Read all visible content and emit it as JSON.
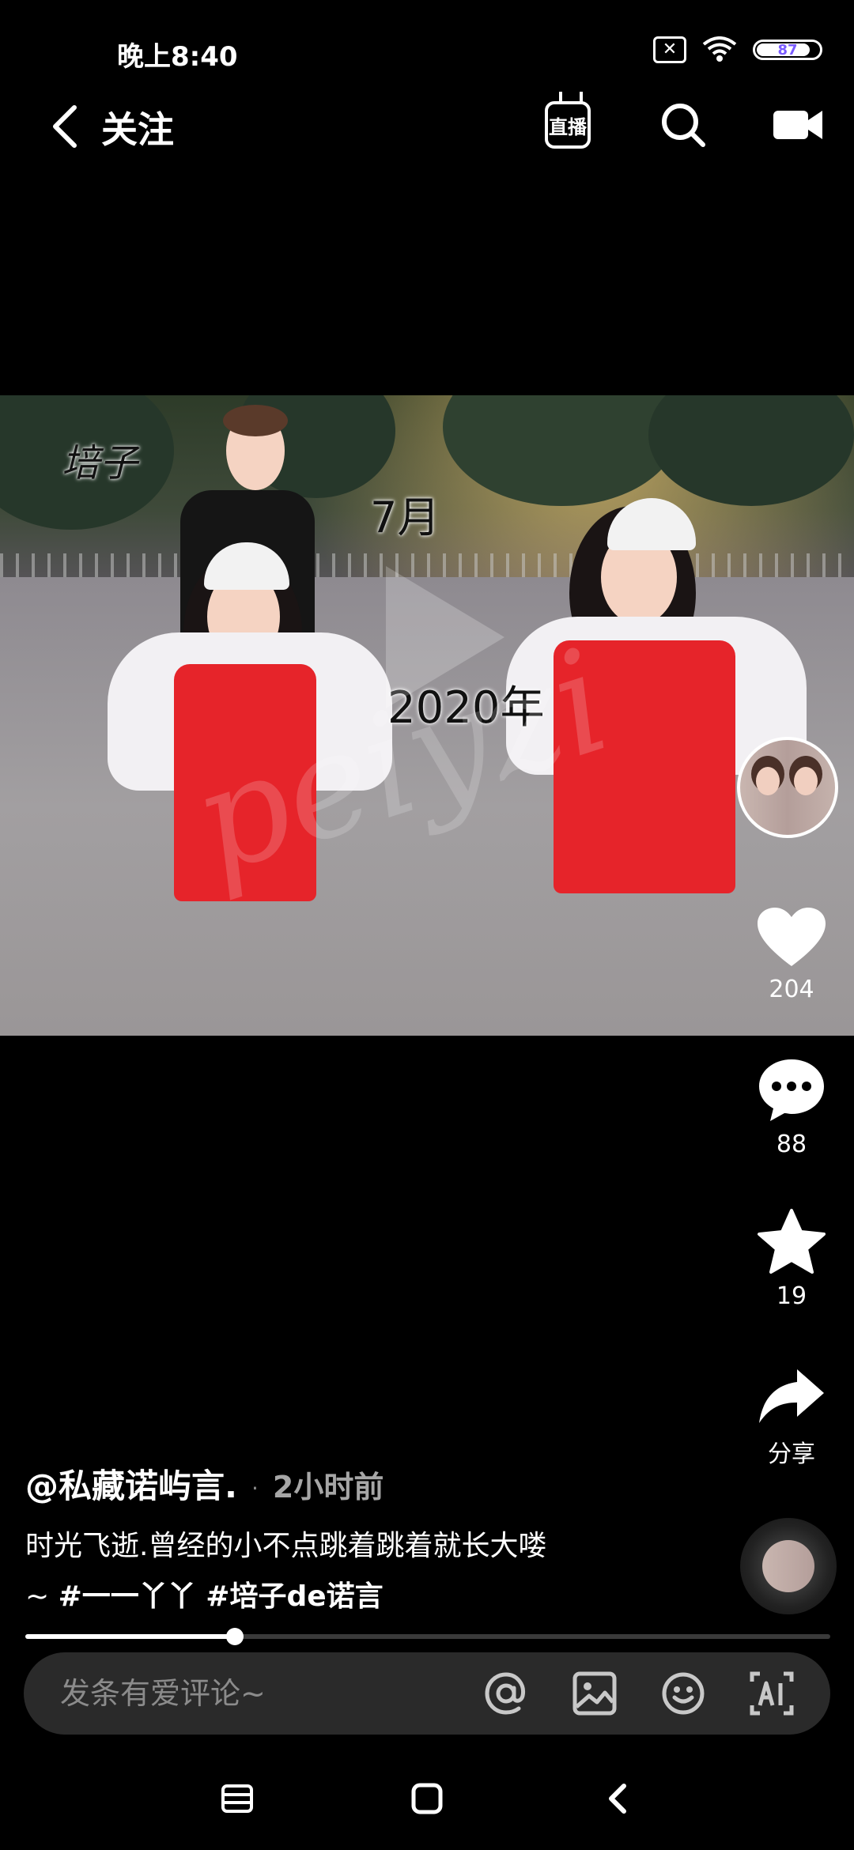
{
  "status_bar": {
    "time": "晚上8:40",
    "battery": "87",
    "sim_icon": "sim-x-icon",
    "wifi_icon": "wifi-icon"
  },
  "nav": {
    "title": "关注",
    "live_label": "直播",
    "icons": [
      "back-icon",
      "live-icon",
      "search-icon",
      "video-icon"
    ]
  },
  "video": {
    "overlay_texts": {
      "handwriting": "培子",
      "month": "7月",
      "year": "2020年"
    },
    "watermark": "peiyzi",
    "play_state": "paused"
  },
  "actions": {
    "likes": "204",
    "comments": "88",
    "favorites": "19",
    "share_label": "分享"
  },
  "post": {
    "author": "@私藏诺屿言.",
    "time": "2小时前",
    "caption_line1": "时光飞逝.曾经的小不点跳着跳着就长大喽",
    "caption_prefix": "~ ",
    "tags": "#一一丫丫 #培子de诺言"
  },
  "playback": {
    "progress": 0.26
  },
  "comment_bar": {
    "placeholder": "发条有爱评论~",
    "icons": [
      "at-icon",
      "image-icon",
      "emoji-icon",
      "ai-icon"
    ]
  },
  "system_nav": [
    "menu-icon",
    "home-icon",
    "back-nav-icon"
  ]
}
